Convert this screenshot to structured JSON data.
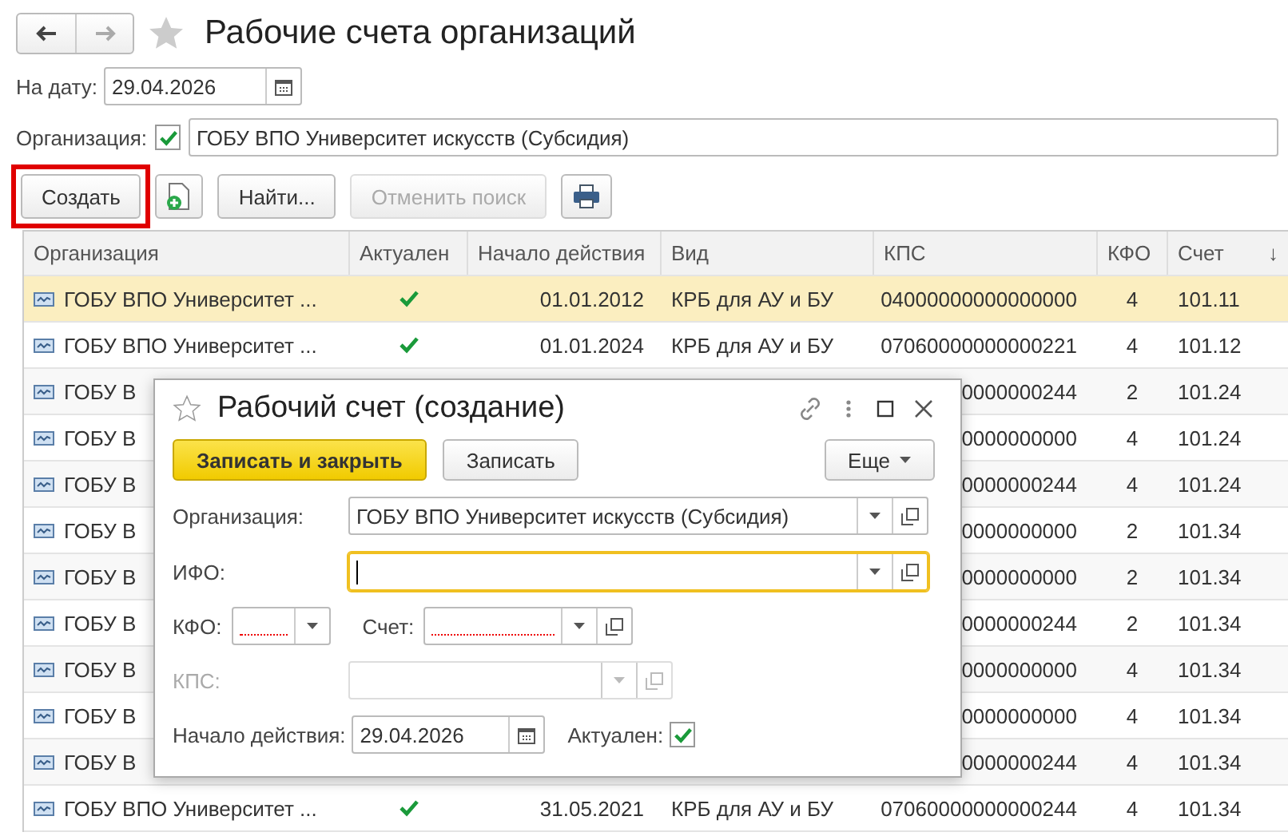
{
  "window": {
    "title": "Рабочие счета организаций",
    "favorite": false
  },
  "date_filter": {
    "label": "На дату:",
    "value": "29.04.2026"
  },
  "org_filter": {
    "label": "Организация:",
    "checked": true,
    "value": "ГОБУ ВПО Университет искусств (Субсидия)"
  },
  "toolbar": [
    {
      "kind": "text",
      "label": "Создать",
      "highlighted": true,
      "disabled": false
    },
    {
      "kind": "add-icon",
      "highlighted": false,
      "disabled": false
    },
    {
      "kind": "text",
      "label": "Найти...",
      "highlighted": false,
      "disabled": false
    },
    {
      "kind": "text",
      "label": "Отменить поиск",
      "highlighted": false,
      "disabled": true
    },
    {
      "kind": "print-icon",
      "highlighted": false,
      "disabled": false
    }
  ],
  "table": {
    "columns": [
      "Организация",
      "Актуален",
      "Начало действия",
      "Вид",
      "КПС",
      "КФО",
      "Счет"
    ],
    "sort_mark": "↓",
    "rows": [
      {
        "selected": true,
        "org": "ГОБУ ВПО Университет ...",
        "active": true,
        "start": "01.01.2012",
        "kind": "КРБ для АУ и БУ",
        "kps": "04000000000000000",
        "kfo": "4",
        "account": "101.11"
      },
      {
        "selected": false,
        "org": "ГОБУ ВПО Университет ...",
        "active": true,
        "start": "01.01.2024",
        "kind": "КРБ для АУ и БУ",
        "kps": "07060000000000221",
        "kfo": "4",
        "account": "101.12"
      },
      {
        "selected": false,
        "org": "ГОБУ В",
        "kps": "0000000244",
        "kfo": "2",
        "account": "101.24"
      },
      {
        "selected": false,
        "org": "ГОБУ В",
        "kps": "0000000000",
        "kfo": "4",
        "account": "101.24"
      },
      {
        "selected": false,
        "org": "ГОБУ В",
        "kps": "0000000244",
        "kfo": "4",
        "account": "101.24"
      },
      {
        "selected": false,
        "org": "ГОБУ В",
        "kps": "0000000000",
        "kfo": "2",
        "account": "101.34"
      },
      {
        "selected": false,
        "org": "ГОБУ В",
        "kps": "0000000000",
        "kfo": "2",
        "account": "101.34"
      },
      {
        "selected": false,
        "org": "ГОБУ В",
        "kps": "0000000244",
        "kfo": "2",
        "account": "101.34"
      },
      {
        "selected": false,
        "org": "ГОБУ В",
        "kps": "0000000000",
        "kfo": "4",
        "account": "101.34"
      },
      {
        "selected": false,
        "org": "ГОБУ В",
        "kps": "0000000000",
        "kfo": "4",
        "account": "101.34"
      },
      {
        "selected": false,
        "org": "ГОБУ В",
        "kps": "0000000244",
        "kfo": "4",
        "account": "101.34"
      },
      {
        "selected": false,
        "org": "ГОБУ ВПО Университет ...",
        "active": true,
        "start": "31.05.2021",
        "kind": "КРБ для АУ и БУ",
        "kps": "07060000000000244",
        "kfo": "4",
        "account": "101.34"
      }
    ]
  },
  "dialog": {
    "title": "Рабочий счет (создание)",
    "favorite": false,
    "buttons": [
      {
        "label": "Записать и закрыть",
        "primary": true
      },
      {
        "label": "Записать",
        "primary": false
      }
    ],
    "more": "Еще",
    "org": {
      "label": "Организация:",
      "value": "ГОБУ ВПО Университет искусств (Субсидия)"
    },
    "ifo": {
      "label": "ИФО:",
      "focused": true
    },
    "kfo": {
      "label": "КФО:",
      "required": true
    },
    "account": {
      "label": "Счет:",
      "required": true
    },
    "kps": {
      "label": "КПС:",
      "disabled": true
    },
    "start": {
      "label": "Начало действия:",
      "value": "29.04.2026"
    },
    "active": {
      "label": "Актуален:",
      "checked": true
    }
  }
}
